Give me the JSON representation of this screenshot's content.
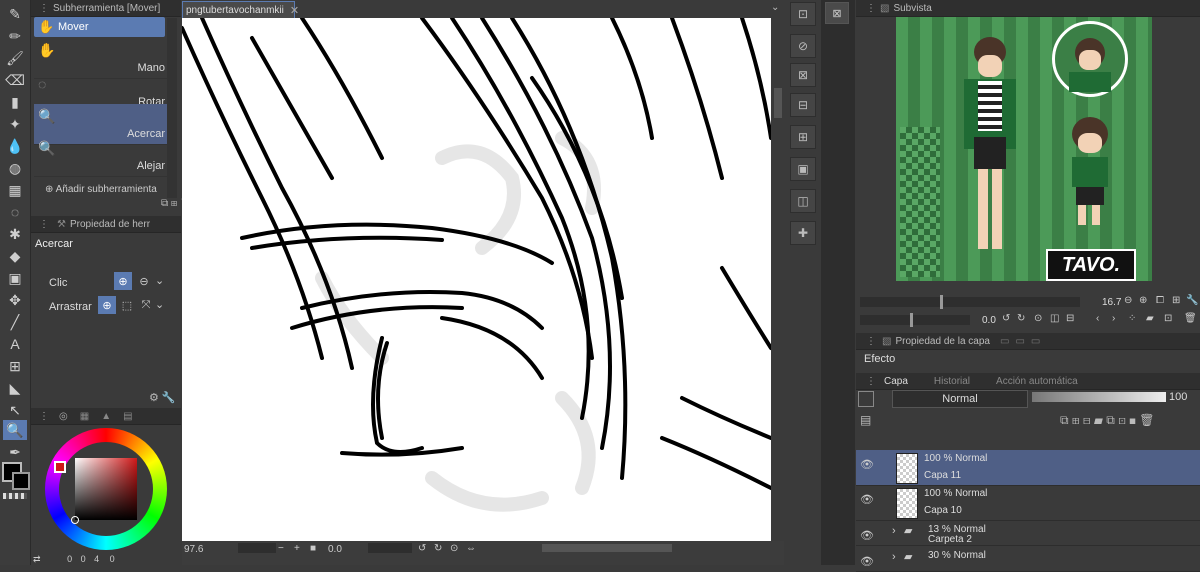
{
  "subtool_panel": {
    "title": "Subherramienta [Mover]",
    "header_label": "Mover",
    "items": [
      {
        "label": "Mano"
      },
      {
        "label": "Rotar"
      },
      {
        "label": "Acercar"
      },
      {
        "label": "Alejar"
      }
    ],
    "add_label": "Añadir subherramienta"
  },
  "tool_property": {
    "title": "Propiedad de herra",
    "tool_name": "Acercar",
    "click_label": "Clic",
    "drag_label": "Arrastrar"
  },
  "color_panel": {
    "counter_a": "0",
    "counter_b": "0",
    "counter_c": "4",
    "counter_d": "0"
  },
  "canvas": {
    "tab_title": "pngtubertavochanmkii",
    "zoom": "97.6",
    "rotation": "0.0"
  },
  "subview": {
    "title": "Subvista",
    "logo_text": "TAVO."
  },
  "navigator": {
    "zoom": "16.7",
    "rotation": "0.0"
  },
  "layer_property": {
    "title": "Propiedad de la capa",
    "effect_label": "Efecto"
  },
  "layer_panel": {
    "tabs": [
      "Capa",
      "Historial",
      "Acción automática"
    ],
    "blend_mode": "Normal",
    "opacity": "100",
    "layers": [
      {
        "line1": "100 % Normal",
        "line2": "Capa 11",
        "selected": true,
        "folder": false
      },
      {
        "line1": "100 % Normal",
        "line2": "Capa 10",
        "selected": false,
        "folder": false
      },
      {
        "line1": "13 % Normal",
        "line2": "Carpeta 2",
        "selected": false,
        "folder": true
      },
      {
        "line1": "30 % Normal",
        "line2": "",
        "selected": false,
        "folder": true
      }
    ]
  },
  "colors": {
    "accent": "#5b7bb2",
    "selected_row": "#4f5f86",
    "panel_bg": "#3a3a3a",
    "subview_green": "#3f8a4a"
  }
}
